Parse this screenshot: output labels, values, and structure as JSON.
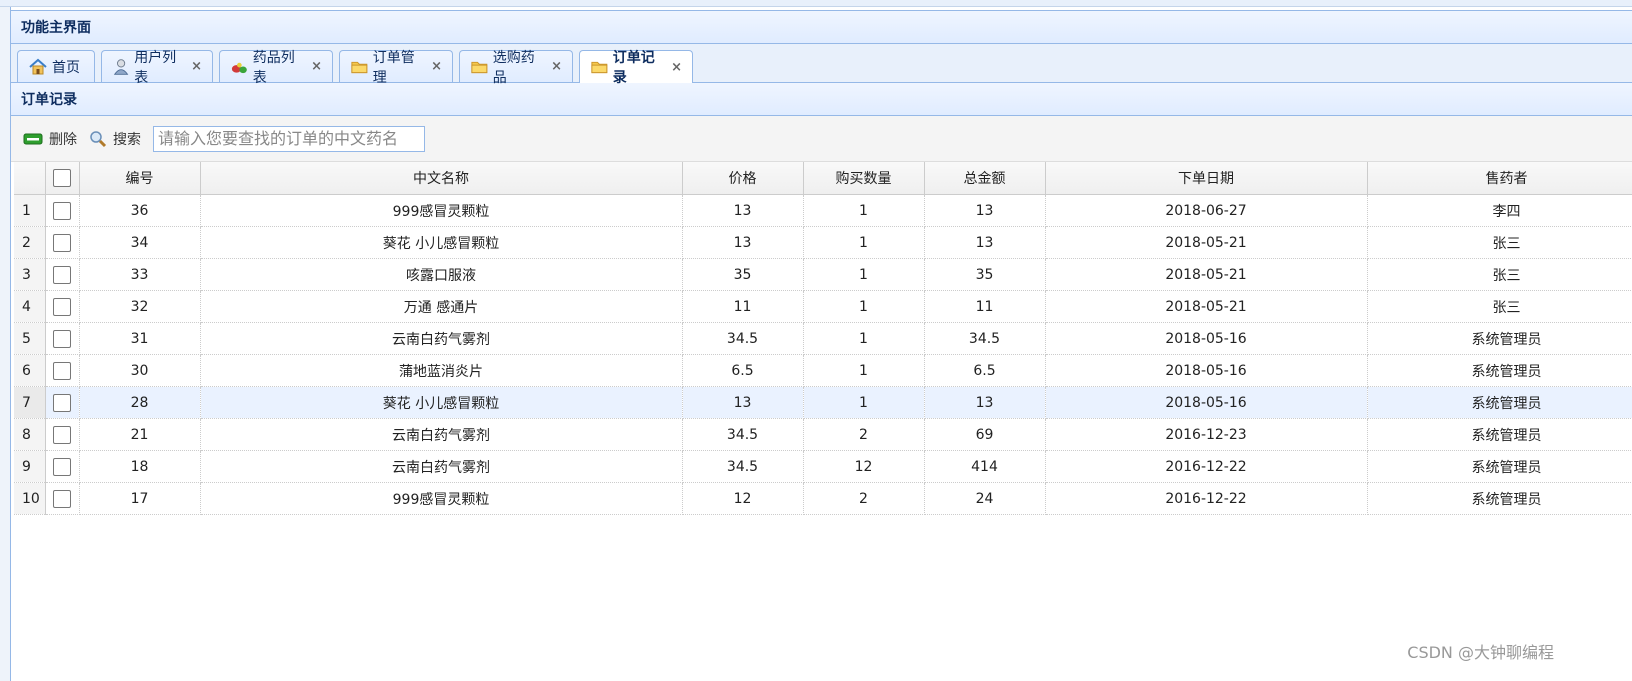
{
  "panel": {
    "title": "功能主界面"
  },
  "tabs": [
    {
      "label": "首页",
      "icon": "home-icon",
      "closable": false
    },
    {
      "label": "用户列表",
      "icon": "user-icon",
      "closable": true
    },
    {
      "label": "药品列表",
      "icon": "pills-icon",
      "closable": true
    },
    {
      "label": "订单管理",
      "icon": "folder-icon",
      "closable": true
    },
    {
      "label": "选购药品",
      "icon": "folder-icon",
      "closable": true
    },
    {
      "label": "订单记录",
      "icon": "folder-icon",
      "closable": true,
      "active": true
    }
  ],
  "tab_close_glyph": "×",
  "content": {
    "title": "订单记录"
  },
  "toolbar": {
    "delete_label": "删除",
    "search_label": "搜索",
    "search_placeholder": "请输入您要查找的订单的中文药名",
    "search_value": ""
  },
  "table": {
    "columns": [
      "编号",
      "中文名称",
      "价格",
      "购买数量",
      "总金额",
      "下单日期",
      "售药者"
    ],
    "rows": [
      {
        "n": "1",
        "id": "36",
        "name": "999感冒灵颗粒",
        "price": "13",
        "qty": "1",
        "total": "13",
        "date": "2018-06-27",
        "seller": "李四"
      },
      {
        "n": "2",
        "id": "34",
        "name": "葵花 小儿感冒颗粒",
        "price": "13",
        "qty": "1",
        "total": "13",
        "date": "2018-05-21",
        "seller": "张三"
      },
      {
        "n": "3",
        "id": "33",
        "name": "咳露口服液",
        "price": "35",
        "qty": "1",
        "total": "35",
        "date": "2018-05-21",
        "seller": "张三"
      },
      {
        "n": "4",
        "id": "32",
        "name": "万通 感通片",
        "price": "11",
        "qty": "1",
        "total": "11",
        "date": "2018-05-21",
        "seller": "张三"
      },
      {
        "n": "5",
        "id": "31",
        "name": "云南白药气雾剂",
        "price": "34.5",
        "qty": "1",
        "total": "34.5",
        "date": "2018-05-16",
        "seller": "系统管理员"
      },
      {
        "n": "6",
        "id": "30",
        "name": "蒲地蓝消炎片",
        "price": "6.5",
        "qty": "1",
        "total": "6.5",
        "date": "2018-05-16",
        "seller": "系统管理员"
      },
      {
        "n": "7",
        "id": "28",
        "name": "葵花 小儿感冒颗粒",
        "price": "13",
        "qty": "1",
        "total": "13",
        "date": "2018-05-16",
        "seller": "系统管理员"
      },
      {
        "n": "8",
        "id": "21",
        "name": "云南白药气雾剂",
        "price": "34.5",
        "qty": "2",
        "total": "69",
        "date": "2016-12-23",
        "seller": "系统管理员"
      },
      {
        "n": "9",
        "id": "18",
        "name": "云南白药气雾剂",
        "price": "34.5",
        "qty": "12",
        "total": "414",
        "date": "2016-12-22",
        "seller": "系统管理员"
      },
      {
        "n": "10",
        "id": "17",
        "name": "999感冒灵颗粒",
        "price": "12",
        "qty": "2",
        "total": "24",
        "date": "2016-12-22",
        "seller": "系统管理员"
      }
    ],
    "highlighted_row": 7
  },
  "watermark": "CSDN @大钟聊编程",
  "colors": {
    "border": "#95b8e7",
    "header_bg": "#e0ecff",
    "title_text": "#0e2d5f",
    "row_highlight": "#eaf2ff"
  }
}
